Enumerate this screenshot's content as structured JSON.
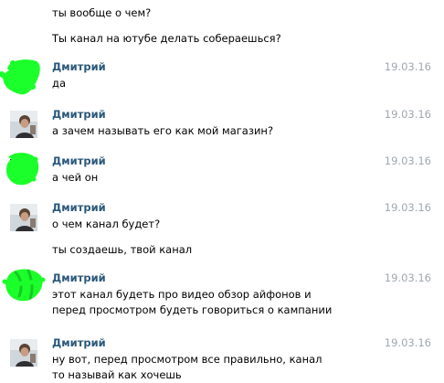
{
  "colors": {
    "author": "#2b587a",
    "date": "#a0a8b0",
    "scribble": "#1bff2a"
  },
  "lines_top": [
    "ты вообще о чем?",
    "Ты канал на ютубе делать собераешься?"
  ],
  "messages": [
    {
      "author": "Дмитрий",
      "date": "19.03.16",
      "text": "да",
      "avatar": "scribble-covered-avatar"
    },
    {
      "author": "Дмитрий",
      "date": "19.03.16",
      "text": "а зачем называть его как мой магазин?",
      "avatar": "photo-avatar"
    },
    {
      "author": "Дмитрий",
      "date": "19.03.16",
      "text": "а чей он",
      "avatar": "scribble-covered-avatar"
    },
    {
      "author": "Дмитрий",
      "date": "19.03.16",
      "text": "о чем канал будет?",
      "avatar": "photo-avatar"
    },
    {
      "author": "Дмитрий",
      "date": "19.03.16",
      "text": "этот канал будеть про видео обзор айфонов и перед просмотром будеть говориться о кампании",
      "avatar": "scribble-covered-avatar"
    },
    {
      "author": "Дмитрий",
      "date": "19.03.16",
      "text": "ну вот, перед просмотром все правильно, канал то называй как хочешь",
      "avatar": "photo-avatar"
    }
  ],
  "line_middle": "ты создаешь, твой канал"
}
